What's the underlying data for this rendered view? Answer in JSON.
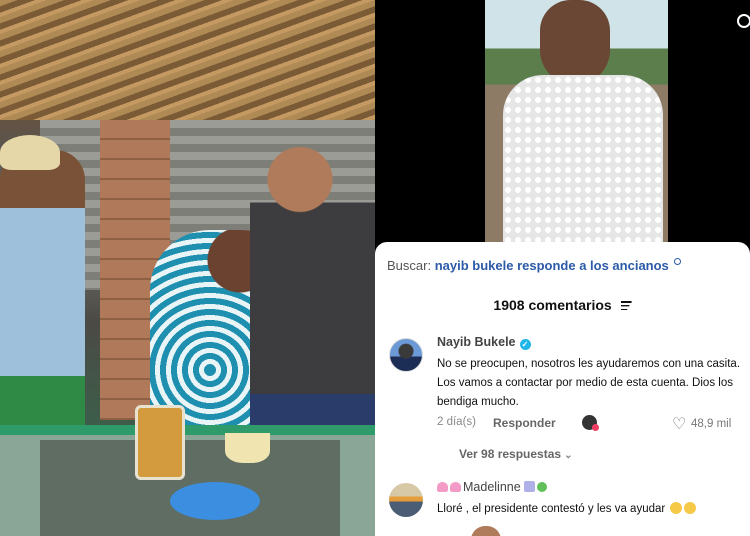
{
  "tiktok": {
    "search": {
      "prefix": "Buscar:",
      "query": "nayib bukele responde a los ancianos"
    },
    "comments_count": "1908 comentarios",
    "comments": [
      {
        "author": "Nayib Bukele",
        "verified": true,
        "text": "No se preocupen, nosotros les ayudaremos con una casita. Los vamos a contactar por medio de esta cuenta. Dios los bendiga mucho.",
        "time": "2 día(s)",
        "reply_label": "Responder",
        "likes": "48,9 mil",
        "view_replies": "Ver 98 respuestas"
      },
      {
        "author": "Madelinne",
        "text": "Lloré , el presidente contestó y les va ayudar"
      }
    ]
  },
  "colors": {
    "query_blue": "#2c5aa8",
    "verified_blue": "#20b7e8",
    "counter_green": "#2f9a6a"
  }
}
